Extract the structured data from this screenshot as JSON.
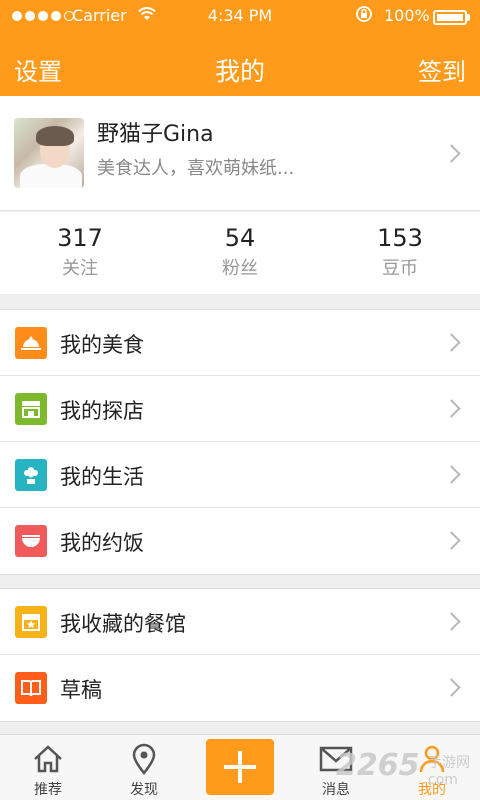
{
  "status_bar": {
    "carrier": "Carrier",
    "time": "4:34 PM",
    "battery": "100%"
  },
  "nav": {
    "left": "设置",
    "title": "我的",
    "right": "签到"
  },
  "profile": {
    "name": "野猫子Gina",
    "bio": "美食达人，喜欢萌妹纸..."
  },
  "stats": [
    {
      "num": "317",
      "label": "关注"
    },
    {
      "num": "54",
      "label": "粉丝"
    },
    {
      "num": "153",
      "label": "豆币"
    }
  ],
  "menu_group1": [
    {
      "label": "我的美食",
      "icon": "food-bell-icon",
      "color": "#ff8c1a"
    },
    {
      "label": "我的探店",
      "icon": "store-icon",
      "color": "#7cb92d"
    },
    {
      "label": "我的生活",
      "icon": "flower-pot-icon",
      "color": "#26b3c2"
    },
    {
      "label": "我的约饭",
      "icon": "bowl-icon",
      "color": "#f05a5a"
    }
  ],
  "menu_group2": [
    {
      "label": "我收藏的餐馆",
      "icon": "star-store-icon",
      "color": "#f7b21a"
    },
    {
      "label": "草稿",
      "icon": "book-icon",
      "color": "#ff5e1a"
    }
  ],
  "tabbar": {
    "tabs": [
      {
        "label": "推荐",
        "icon": "home-icon"
      },
      {
        "label": "发现",
        "icon": "location-pin-icon"
      },
      {
        "label": "消息",
        "icon": "mail-icon"
      },
      {
        "label": "我的",
        "icon": "user-icon"
      }
    ],
    "add_icon": "plus-icon"
  },
  "watermark": {
    "main": "2265",
    "sub": "手游网",
    "domain": "com"
  },
  "colors": {
    "accent": "#ff9a1a"
  }
}
